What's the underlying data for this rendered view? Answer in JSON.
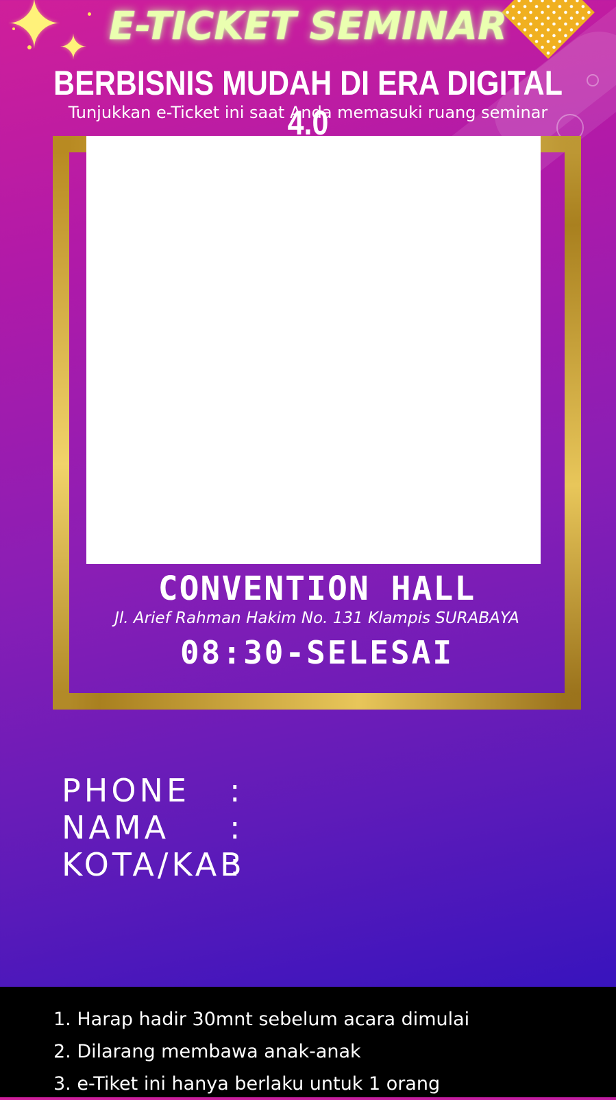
{
  "header": {
    "title": "E-TICKET SEMINAR",
    "subtitle": "BERBISNIS MUDAH DI ERA DIGITAL 4.0",
    "instruction": "Tunjukkan e-Ticket ini saat Anda memasuki ruang seminar"
  },
  "event": {
    "venue": "CONVENTION HALL",
    "address": "Jl. Arief Rahman Hakim No. 131 Klampis SURABAYA",
    "time": "08:30-SELESAI"
  },
  "fields": [
    {
      "label": "PHONE",
      "colon": ":"
    },
    {
      "label": "NAMA",
      "colon": ":"
    },
    {
      "label": "KOTA/KAB",
      "colon": ":"
    }
  ],
  "rules": [
    "1. Harap hadir 30mnt sebelum acara dimulai",
    "2. Dilarang membawa anak-anak",
    "3. e-Tiket ini hanya berlaku untuk 1 orang"
  ],
  "colors": {
    "gradient_top": "#d01f9a",
    "gradient_bottom": "#2f12c0",
    "gold_frame": "#c89a2c",
    "title_glow": "#eaffb0"
  },
  "icons": {
    "sparkle": "sparkle-icon",
    "diamond": "diamond-decoration"
  }
}
